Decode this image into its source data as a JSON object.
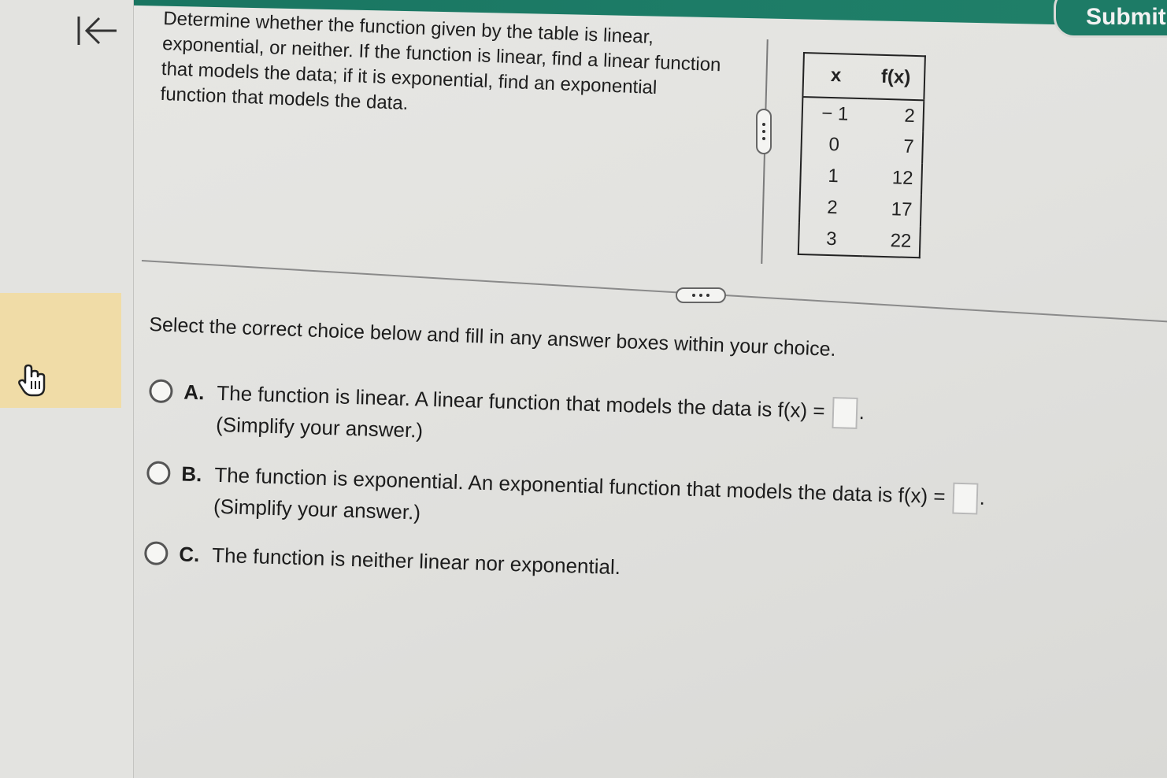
{
  "header": {
    "submit_label": "Submit",
    "back_icon": "collapse-left-arrow-icon"
  },
  "question": {
    "text": "Determine whether the function given by the table is linear, exponential, or neither. If the function is linear, find a linear function that models the data; if it is exponential, find an exponential function that models the data."
  },
  "table": {
    "headers": [
      "x",
      "f(x)"
    ],
    "rows": [
      [
        "− 1",
        "2"
      ],
      [
        "0",
        "7"
      ],
      [
        "1",
        "12"
      ],
      [
        "2",
        "17"
      ],
      [
        "3",
        "22"
      ]
    ]
  },
  "instruction": "Select the correct choice below and fill in any answer boxes within your choice.",
  "choices": {
    "a": {
      "letter": "A.",
      "text": "The function is linear. A linear function that models the data is f(x) =",
      "note": "(Simplify your answer.)"
    },
    "b": {
      "letter": "B.",
      "text": "The function is exponential. An exponential function that models the data is f(x) =",
      "note": "(Simplify your answer.)"
    },
    "c": {
      "letter": "C.",
      "text": "The function is neither linear nor exponential."
    }
  },
  "colors": {
    "header_green": "#1d7b66",
    "highlight": "#f0dca7"
  }
}
